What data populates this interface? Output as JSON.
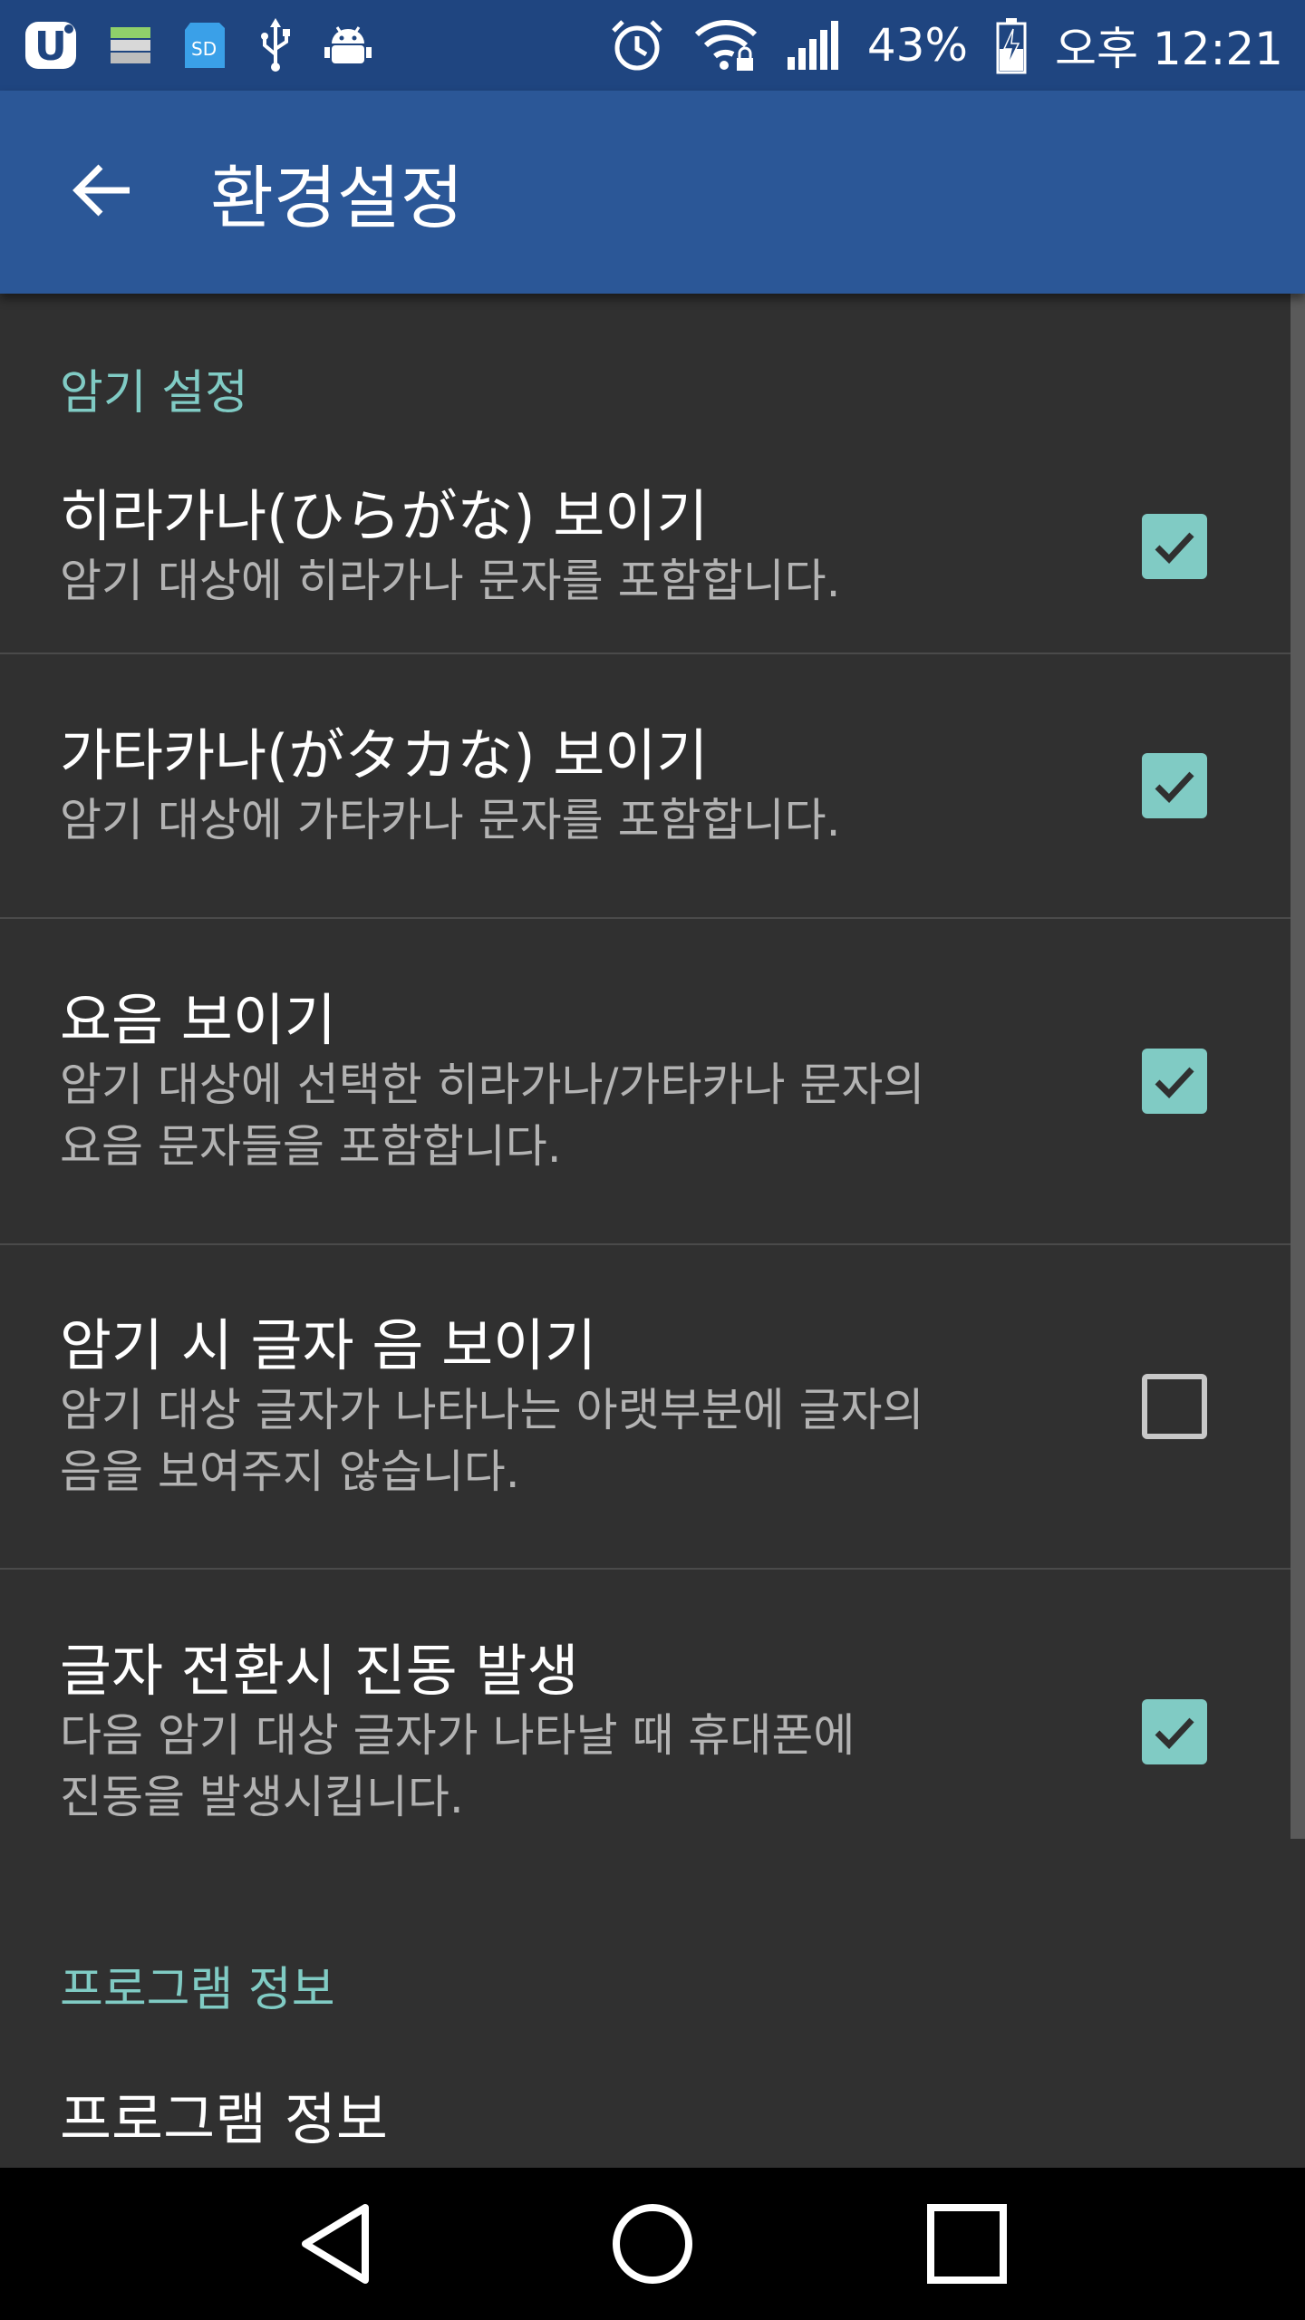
{
  "status_bar": {
    "battery_percent": "43%",
    "time": "오후 12:21",
    "left_icons": [
      "u-plus-icon",
      "storage-icon",
      "sd-card-icon",
      "usb-icon",
      "android-debug-icon"
    ],
    "right_icons": [
      "alarm-icon",
      "wifi-lock-icon",
      "signal-icon",
      "battery-charging-icon"
    ],
    "sd_label": "SD"
  },
  "app_bar": {
    "title": "환경설정",
    "back_icon": "arrow-back-icon"
  },
  "sections": [
    {
      "header": "암기 설정",
      "items": [
        {
          "title": "히라가나(ひらがな) 보이기",
          "summary": "암기 대상에 히라가나 문자를 포함합니다.",
          "checked": true
        },
        {
          "title": "가타카나(がタカな) 보이기",
          "summary": "암기 대상에 가타카나 문자를 포함합니다.",
          "checked": true
        },
        {
          "title": "요음 보이기",
          "summary": "암기 대상에 선택한 히라가나/가타카나 문자의\n요음 문자들을 포함합니다.",
          "checked": true
        },
        {
          "title": "암기 시 글자 음 보이기",
          "summary": "암기 대상 글자가 나타나는 아랫부분에 글자의\n음을 보여주지 않습니다.",
          "checked": false
        },
        {
          "title": "글자 전환시 진동 발생",
          "summary": "다음 암기 대상 글자가 나타날 때 휴대폰에\n진동을 발생시킵니다.",
          "checked": true
        }
      ]
    },
    {
      "header": "프로그램 정보",
      "items": [
        {
          "title": "프로그램 정보"
        }
      ]
    }
  ],
  "nav_bar": {
    "icons": [
      "back-triangle-icon",
      "home-circle-icon",
      "recents-square-icon"
    ]
  },
  "colors": {
    "status_bar": "#1f4580",
    "app_bar": "#2b5797",
    "background": "#303030",
    "accent": "#80cbc4"
  }
}
